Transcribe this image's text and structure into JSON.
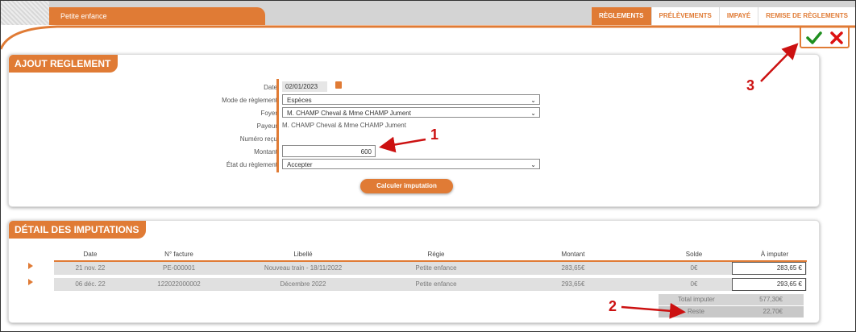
{
  "header": {
    "app_tab": "Petite enfance"
  },
  "tabs": [
    {
      "label": "RÈGLEMENTS",
      "active": true
    },
    {
      "label": "PRÉLÈVEMENTS",
      "active": false
    },
    {
      "label": "IMPAYÉ",
      "active": false
    },
    {
      "label": "REMISE DE RÈGLEMENTS",
      "active": false
    }
  ],
  "actions": {
    "confirm_icon": "check-icon",
    "cancel_icon": "close-icon"
  },
  "form": {
    "title": "AJOUT REGLEMENT",
    "labels": {
      "date": "Date",
      "mode": "Mode de règlement",
      "foyer": "Foyer",
      "payeur": "Payeur",
      "numero": "Numéro reçu",
      "montant": "Montant",
      "etat": "État du règlement"
    },
    "date_value": "02/01/2023",
    "mode_value": "Espèces",
    "foyer_value": "M. CHAMP Cheval & Mme CHAMP Jument",
    "payeur_value": "M. CHAMP Cheval  & Mme CHAMP Jument",
    "numero_value": "",
    "montant_value": "600",
    "etat_value": "Accepter",
    "calc_button": "Calculer imputation"
  },
  "detail": {
    "title": "DÉTAIL DES IMPUTATIONS",
    "columns": [
      "Date",
      "N° facture",
      "Libellé",
      "Régie",
      "Montant",
      "Solde",
      "À imputer"
    ],
    "rows": [
      {
        "date": "21 nov. 22",
        "facture": "PE-000001",
        "libelle": "Nouveau train - 18/11/2022",
        "regie": "Petite enfance",
        "montant": "283,65€",
        "solde": "0€",
        "imputer": "283,65",
        "unit": "€"
      },
      {
        "date": "06 déc. 22",
        "facture": "122022000002",
        "libelle": "Décembre 2022",
        "regie": "Petite enfance",
        "montant": "293,65€",
        "solde": "0€",
        "imputer": "293,65",
        "unit": "€"
      }
    ],
    "total_label": "Total imputer",
    "total_value": "577,30€",
    "reste_label": "Reste",
    "reste_value": "22,70€"
  },
  "annotations": {
    "one": "1",
    "two": "2",
    "three": "3"
  },
  "colors": {
    "accent": "#e07b35",
    "annotation": "#cc1111",
    "confirm": "#1f8f1f"
  }
}
